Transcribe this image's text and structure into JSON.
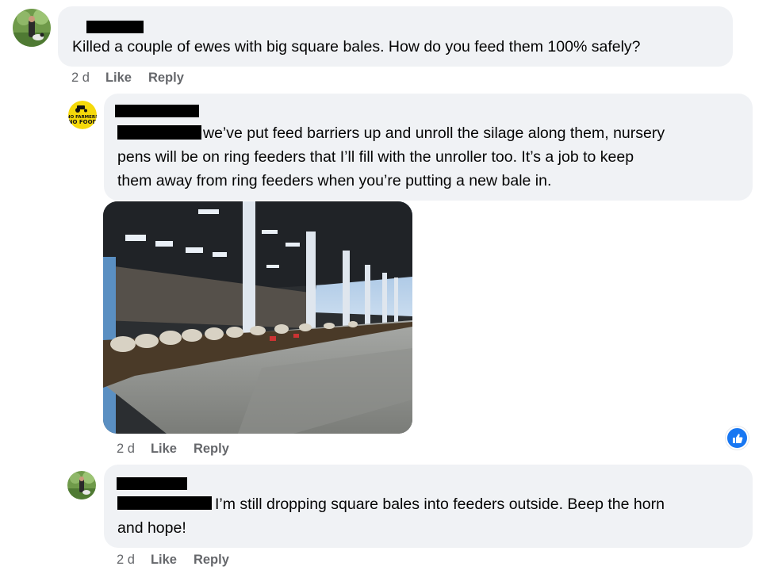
{
  "comments": [
    {
      "text": "Killed a couple of ewes with big square bales. How do you feed them 100% safely?",
      "time": "2 d",
      "like": "Like",
      "reply": "Reply"
    },
    {
      "badge_text": "NO FARMERS NO FOOD",
      "lines": [
        "we’ve put feed barriers up and unroll the silage along them, nursery",
        "pens will be on ring feeders that I’ll fill with the unroller too. It’s a job to keep",
        "them away from ring feeders when you’re putting a new bale in."
      ],
      "time": "2 d",
      "like": "Like",
      "reply": "Reply",
      "reaction_icon": "thumbs-up-icon"
    },
    {
      "lines": [
        "I’m still dropping square bales into feeders outside. Beep the horn",
        "and hope!"
      ],
      "time": "2 d",
      "like": "Like",
      "reply": "Reply"
    }
  ],
  "colors": {
    "bubble": "#f0f2f5",
    "meta": "#65676b",
    "accent": "#1877f2",
    "badge_yellow": "#f5d90a"
  }
}
